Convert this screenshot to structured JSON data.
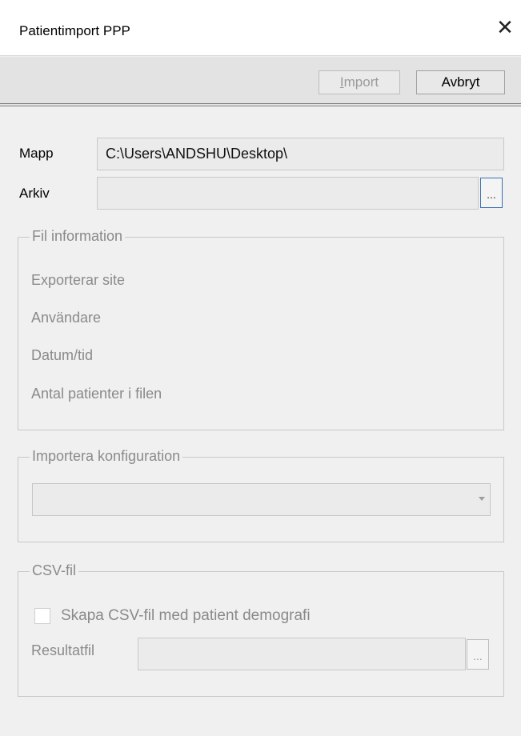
{
  "window": {
    "title": "Patientimport PPP",
    "close_glyph": "✕"
  },
  "toolbar": {
    "import_label_mnemonic": "I",
    "import_label_rest": "mport",
    "cancel_label": "Avbryt"
  },
  "form": {
    "folder_label": "Mapp",
    "folder_value": "C:\\Users\\ANDSHU\\Desktop\\",
    "archive_label": "Arkiv",
    "archive_value": "",
    "browse_label": "..."
  },
  "file_info": {
    "legend": "Fil information",
    "items": [
      "Exporterar site",
      "Användare",
      "Datum/tid",
      "Antal patienter i filen"
    ]
  },
  "import_config": {
    "legend": "Importera konfiguration",
    "selected": ""
  },
  "csv": {
    "legend": "CSV-fil",
    "checkbox_label": "Skapa CSV-fil med patient demografi",
    "checked": false,
    "result_label": "Resultatfil",
    "result_value": "",
    "browse_label": "..."
  }
}
